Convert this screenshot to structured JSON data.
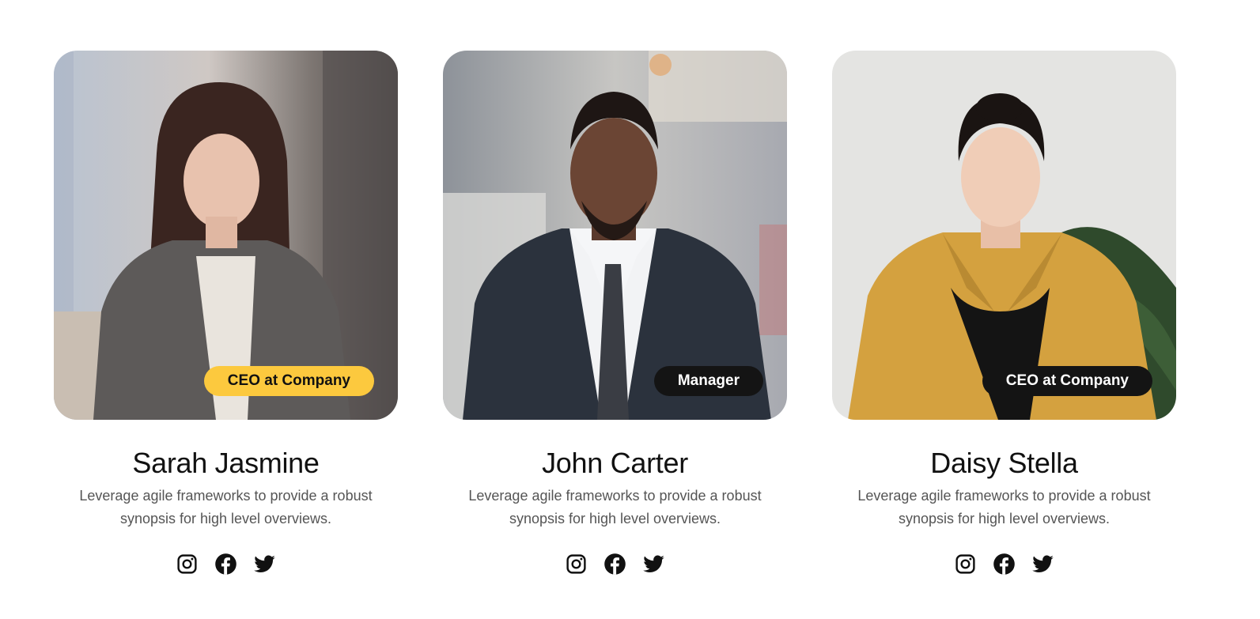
{
  "members": [
    {
      "name": "Sarah Jasmine",
      "role": "CEO at Company",
      "description": "Leverage agile frameworks to provide a robust synopsis for high level overviews.",
      "badge_color": "#fcc93e"
    },
    {
      "name": "John Carter",
      "role": "Manager",
      "description": "Leverage agile frameworks to provide a robust synopsis for high level overviews.",
      "badge_color": "#141414"
    },
    {
      "name": "Daisy Stella",
      "role": "CEO at Company",
      "description": "Leverage agile frameworks to provide a robust synopsis for high level overviews.",
      "badge_color": "#141414"
    }
  ],
  "social_icons": [
    "instagram-icon",
    "facebook-icon",
    "twitter-icon"
  ]
}
